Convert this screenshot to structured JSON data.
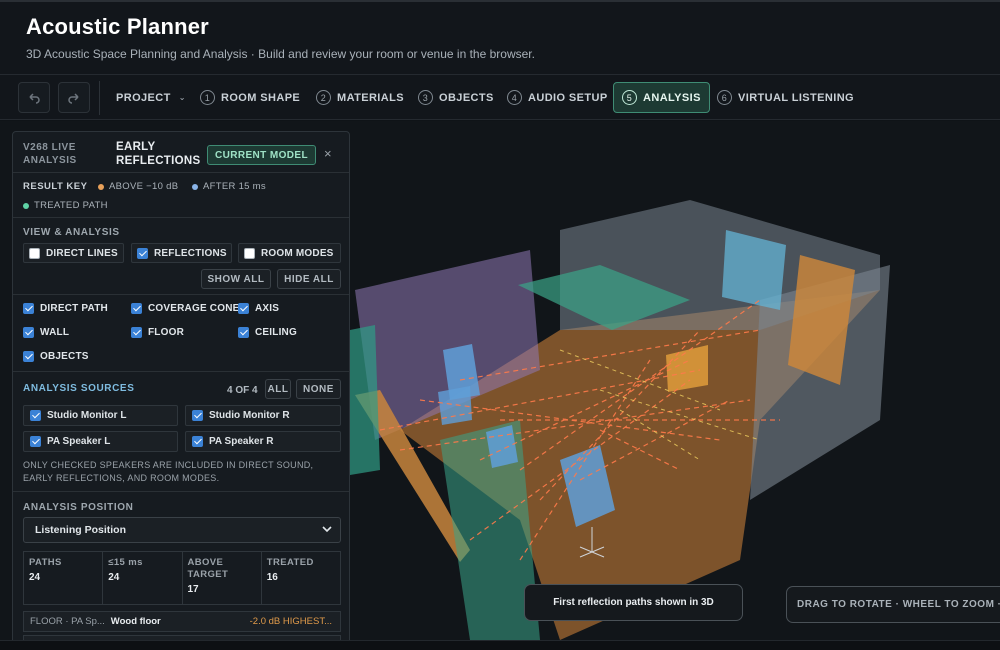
{
  "header": {
    "title": "Acoustic Planner",
    "subtitle": "3D Acoustic Space Planning and Analysis · Build and review your room or venue in the browser."
  },
  "toolbar": {
    "undo_icon": "undo-icon",
    "redo_icon": "redo-icon",
    "project_label": "PROJECT",
    "steps": [
      {
        "num": "1",
        "label": "ROOM SHAPE"
      },
      {
        "num": "2",
        "label": "MATERIALS"
      },
      {
        "num": "3",
        "label": "OBJECTS"
      },
      {
        "num": "4",
        "label": "AUDIO SETUP"
      },
      {
        "num": "5",
        "label": "ANALYSIS",
        "active": true
      },
      {
        "num": "6",
        "label": "VIRTUAL LISTENING"
      }
    ]
  },
  "panel": {
    "kicker": "V268 LIVE ANALYSIS",
    "title": "EARLY REFLECTIONS",
    "badge": "CURRENT MODEL",
    "close": "×",
    "result_key": {
      "label": "RESULT KEY",
      "items": [
        {
          "label": "ABOVE −10 dB",
          "color": "#e8a15a"
        },
        {
          "label": "AFTER 15 ms",
          "color": "#8ab4e8"
        },
        {
          "label": "TREATED PATH",
          "color": "#5fd3a6"
        }
      ]
    },
    "view_analysis": {
      "label": "VIEW & ANALYSIS",
      "modes": [
        {
          "label": "DIRECT LINES",
          "checked": false
        },
        {
          "label": "REFLECTIONS",
          "checked": true
        },
        {
          "label": "ROOM MODES",
          "checked": false
        }
      ],
      "show_all": "SHOW ALL",
      "hide_all": "HIDE ALL",
      "layers": [
        {
          "label": "DIRECT PATH",
          "checked": true
        },
        {
          "label": "COVERAGE CONE",
          "checked": true
        },
        {
          "label": "AXIS",
          "checked": true
        },
        {
          "label": "WALL",
          "checked": true
        },
        {
          "label": "FLOOR",
          "checked": true
        },
        {
          "label": "CEILING",
          "checked": true
        },
        {
          "label": "OBJECTS",
          "checked": true
        }
      ]
    },
    "sources": {
      "label": "ANALYSIS SOURCES",
      "count": "4 OF 4",
      "all": "ALL",
      "none": "NONE",
      "items": [
        {
          "label": "Studio Monitor L",
          "checked": true
        },
        {
          "label": "Studio Monitor R",
          "checked": true
        },
        {
          "label": "PA Speaker L",
          "checked": true
        },
        {
          "label": "PA Speaker R",
          "checked": true
        }
      ],
      "note": "ONLY CHECKED SPEAKERS ARE INCLUDED IN DIRECT SOUND, EARLY REFLECTIONS, AND ROOM MODES."
    },
    "position": {
      "label": "ANALYSIS POSITION",
      "selected": "Listening Position"
    },
    "stats": [
      {
        "label": "PATHS",
        "value": "24"
      },
      {
        "label": "≤15 ms",
        "value": "24"
      },
      {
        "label": "ABOVE TARGET",
        "value": "17"
      },
      {
        "label": "TREATED",
        "value": "16"
      }
    ],
    "result_row": {
      "source": "FLOOR · PA Sp...",
      "surface": "Wood floor",
      "level": "-2.0 dB HIGHEST..."
    }
  },
  "viewport": {
    "toast": "First reflection paths shown in 3D",
    "hint": "DRAG TO ROTATE · WHEEL TO ZOOM · S"
  }
}
